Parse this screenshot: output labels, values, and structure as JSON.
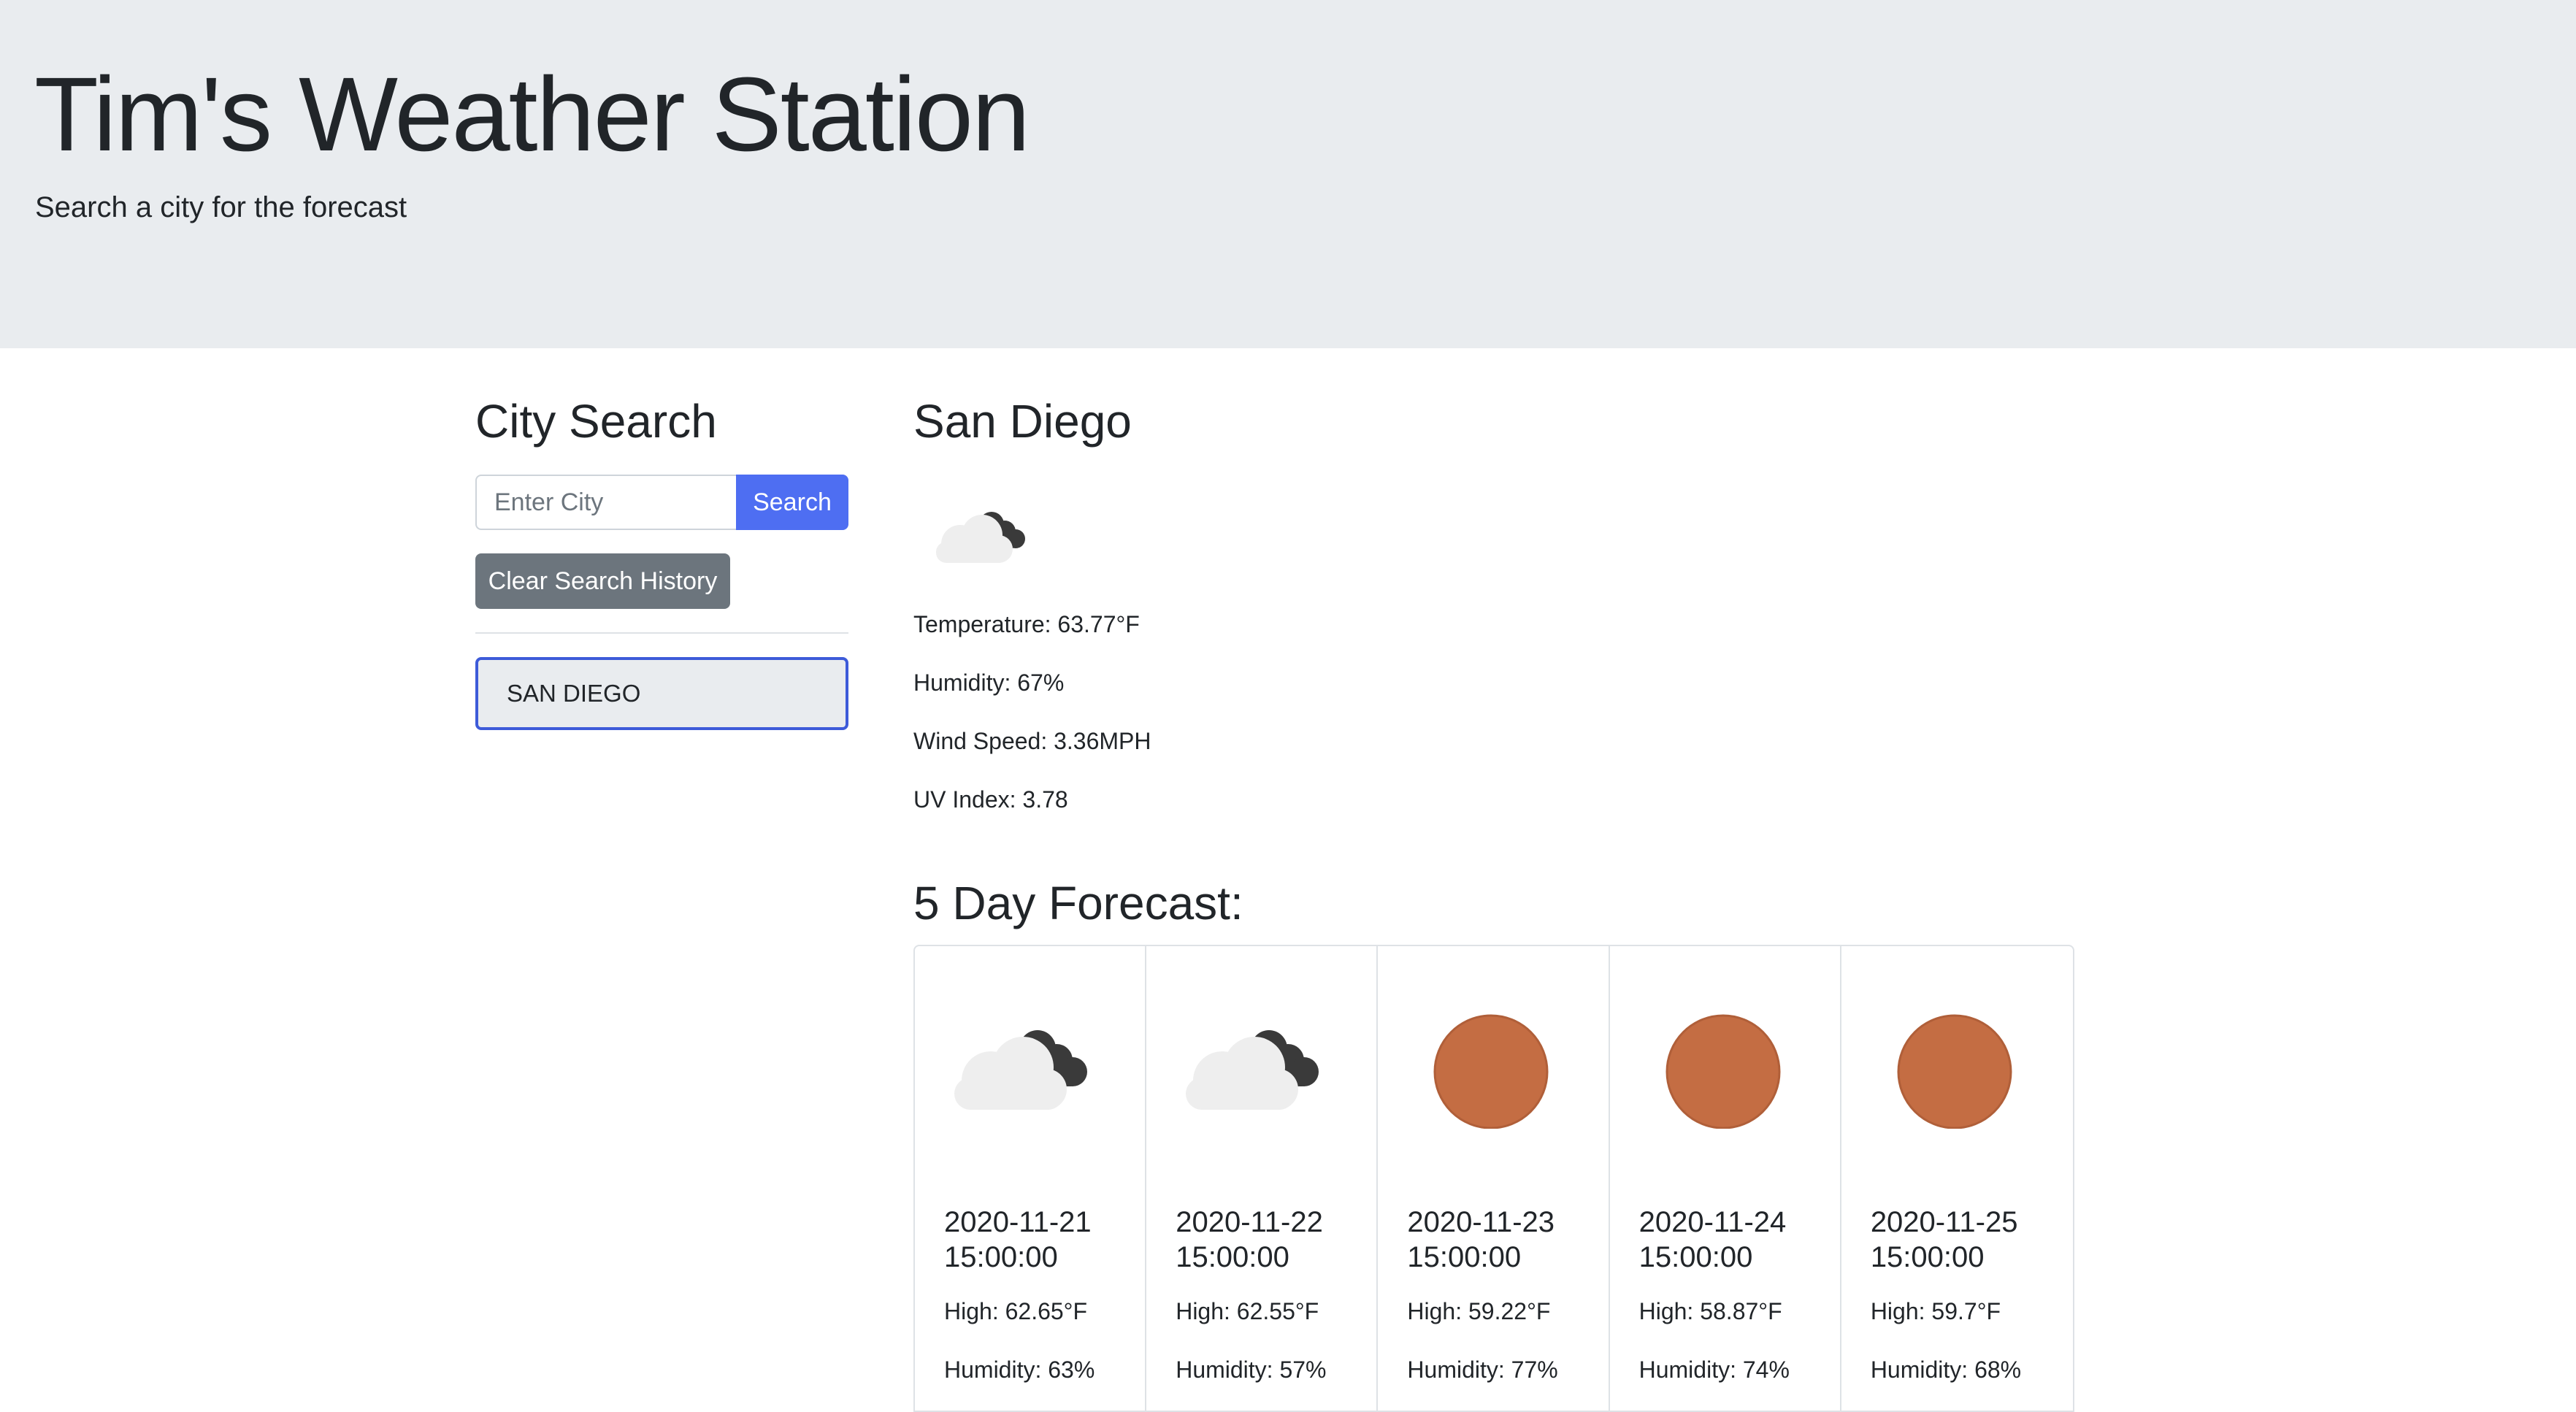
{
  "header": {
    "title": "Tim's Weather Station",
    "subtitle": "Search a city for the forecast"
  },
  "search": {
    "heading": "City Search",
    "placeholder": "Enter City",
    "value": "",
    "button_label": "Search",
    "clear_label": "Clear Search History",
    "history": [
      "SAN DIEGO"
    ]
  },
  "current": {
    "city": "San Diego",
    "icon": "night-cloudy-icon",
    "temperature": "Temperature: 63.77°F",
    "humidity": "Humidity: 67%",
    "wind": "Wind Speed: 3.36MPH",
    "uv": "UV Index: 3.78"
  },
  "forecast": {
    "heading": "5 Day Forecast:",
    "days": [
      {
        "date": "2020-11-21 15:00:00",
        "high": "High: 62.65°F",
        "humidity": "Humidity: 63%",
        "icon": "night-cloudy-icon"
      },
      {
        "date": "2020-11-22 15:00:00",
        "high": "High: 62.55°F",
        "humidity": "Humidity: 57%",
        "icon": "night-cloudy-icon"
      },
      {
        "date": "2020-11-23 15:00:00",
        "high": "High: 59.22°F",
        "humidity": "Humidity: 77%",
        "icon": "clear-sun-icon"
      },
      {
        "date": "2020-11-24 15:00:00",
        "high": "High: 58.87°F",
        "humidity": "Humidity: 74%",
        "icon": "clear-sun-icon"
      },
      {
        "date": "2020-11-25 15:00:00",
        "high": "High: 59.7°F",
        "humidity": "Humidity: 68%",
        "icon": "clear-sun-icon"
      }
    ]
  },
  "colors": {
    "jumbotron": "#e9ecef",
    "primary": "#4e6ef2",
    "secondary": "#6c757d",
    "sun": "#c46d43",
    "cloud_light": "#eeeeee",
    "cloud_dark": "#3a3a3a",
    "active_border": "#3d5bd9"
  }
}
